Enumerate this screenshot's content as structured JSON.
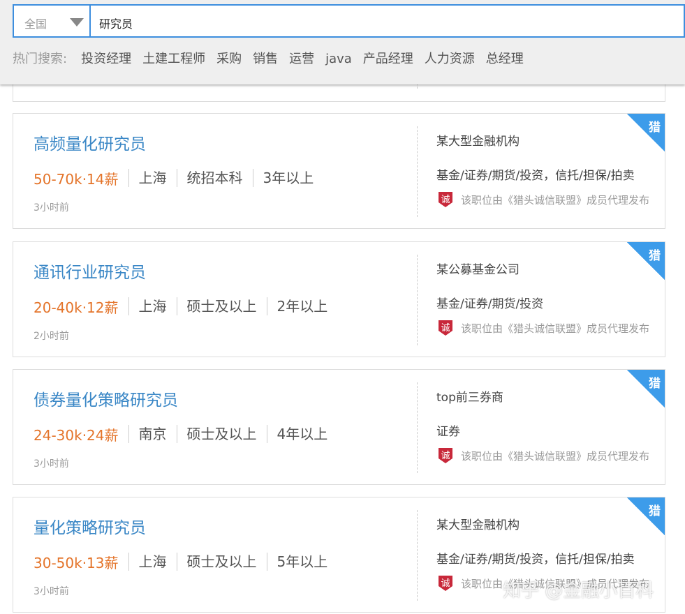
{
  "search": {
    "region": "全国",
    "query": "研究员"
  },
  "hot_search": {
    "label": "热门搜索:",
    "links": [
      "投资经理",
      "土建工程师",
      "采购",
      "销售",
      "运营",
      "java",
      "产品经理",
      "人力资源",
      "总经理"
    ]
  },
  "jobs": [
    {
      "title": "高频量化研究员",
      "salary": "50-70k·14薪",
      "location": "上海",
      "education": "统招本科",
      "experience": "3年以上",
      "posted": "3小时前",
      "company": "某大型金融机构",
      "industry": "基金/证券/期货/投资，信托/担保/拍卖",
      "agent_note": "该职位由《猎头诚信联盟》成员代理发布",
      "badge": "猎"
    },
    {
      "title": "通讯行业研究员",
      "salary": "20-40k·12薪",
      "location": "上海",
      "education": "硕士及以上",
      "experience": "2年以上",
      "posted": "2小时前",
      "company": "某公募基金公司",
      "industry": "基金/证券/期货/投资",
      "agent_note": "该职位由《猎头诚信联盟》成员代理发布",
      "badge": "猎"
    },
    {
      "title": "债券量化策略研究员",
      "salary": "24-30k·24薪",
      "location": "南京",
      "education": "硕士及以上",
      "experience": "4年以上",
      "posted": "3小时前",
      "company": "top前三券商",
      "industry": "证券",
      "agent_note": "该职位由《猎头诚信联盟》成员代理发布",
      "badge": "猎"
    },
    {
      "title": "量化策略研究员",
      "salary": "30-50k·13薪",
      "location": "上海",
      "education": "硕士及以上",
      "experience": "5年以上",
      "posted": "3小时前",
      "company": "某大型金融机构",
      "industry": "基金/证券/期货/投资，信托/担保/拍卖",
      "agent_note": "该职位由《猎头诚信联盟》成员代理发布",
      "badge": "猎"
    }
  ],
  "watermark": "知乎 @金融小百科",
  "colors": {
    "accent": "#3d8ede",
    "title": "#3a87c6",
    "salary": "#e4742a",
    "badge": "#3d9cea",
    "cheng_icon": "#c8283a"
  }
}
